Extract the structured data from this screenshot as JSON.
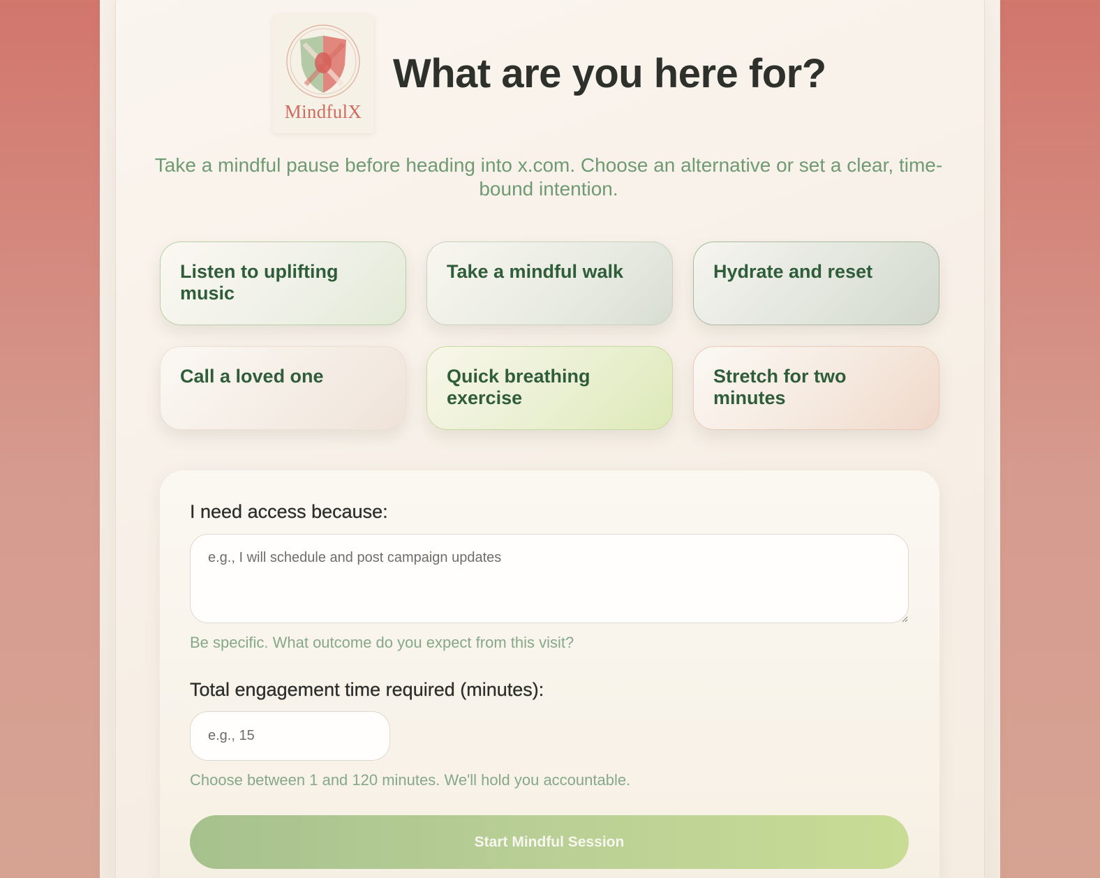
{
  "app": {
    "logo_text": "MindfulX",
    "logo_icon": "shield-icon"
  },
  "header": {
    "title": "What are you here for?",
    "subtitle": "Take a mindful pause before heading into x.com. Choose an alternative or set a clear, time-bound intention."
  },
  "alternatives": [
    {
      "label": "Listen to uplifting music"
    },
    {
      "label": "Take a mindful walk"
    },
    {
      "label": "Hydrate and reset"
    },
    {
      "label": "Call a loved one"
    },
    {
      "label": "Quick breathing exercise"
    },
    {
      "label": "Stretch for two minutes"
    }
  ],
  "form": {
    "reason_label": "I need access because:",
    "reason_value": "",
    "reason_placeholder": "e.g., I will schedule and post campaign updates",
    "reason_hint": "Be specific. What outcome do you expect from this visit?",
    "time_label": "Total engagement time required (minutes):",
    "time_value": "",
    "time_placeholder": "e.g., 15",
    "time_hint": "Choose between 1 and 120 minutes. We'll hold you accountable.",
    "submit_label": "Start Mindful Session"
  },
  "colors": {
    "accent_green": "#2f5d3a",
    "brand_red": "#cf6a5e",
    "hint_green": "#86a889",
    "button_green": "#b9cf95"
  }
}
